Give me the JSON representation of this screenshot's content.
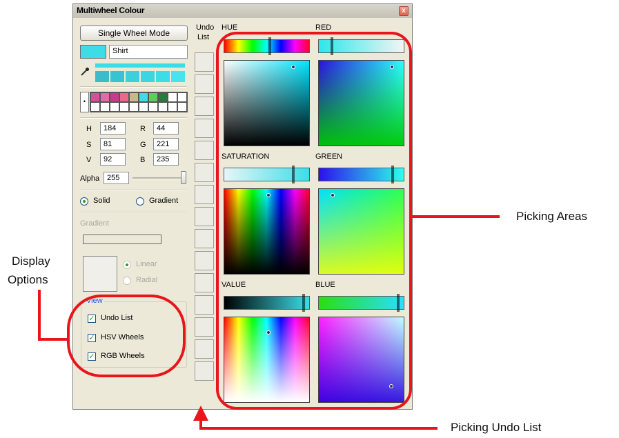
{
  "window": {
    "title": "Multiwheel Colour",
    "close_glyph": "x"
  },
  "left_panel": {
    "mode_button": "Single Wheel Mode",
    "current_color": "#3cdde7",
    "color_name": "Shirt",
    "eyedropper_icon": "eyedropper-icon",
    "palette_toggle": "•",
    "values": {
      "h_label": "H",
      "h": "184",
      "s_label": "S",
      "s": "81",
      "v_label": "V",
      "v": "92",
      "r_label": "R",
      "r": "44",
      "g_label": "G",
      "g": "221",
      "b_label": "B",
      "b": "235"
    },
    "alpha_label": "Alpha",
    "alpha_value": "255",
    "fill_solid": "Solid",
    "fill_gradient": "Gradient",
    "gradient_label": "Gradient",
    "linear_label": "Linear",
    "radial_label": "Radial",
    "view_label": "View",
    "view_options": [
      {
        "label": "Undo List",
        "checked": true
      },
      {
        "label": "HSV Wheels",
        "checked": true
      },
      {
        "label": "RGB Wheels",
        "checked": true
      }
    ]
  },
  "undo_list": {
    "label_line1": "Undo",
    "label_line2": "List"
  },
  "wheels": {
    "hue_label": "HUE",
    "red_label": "RED",
    "saturation_label": "SATURATION",
    "green_label": "GREEN",
    "value_label": "VALUE",
    "blue_label": "BLUE"
  },
  "annotations": {
    "picking_areas": "Picking Areas",
    "display_options_line1": "Display",
    "display_options_line2": "Options",
    "picking_undo_list": "Picking Undo List"
  },
  "colors": {
    "accent": "#3cdde7",
    "annotation_red": "#e8151b",
    "window_bg": "#ece9d8"
  }
}
